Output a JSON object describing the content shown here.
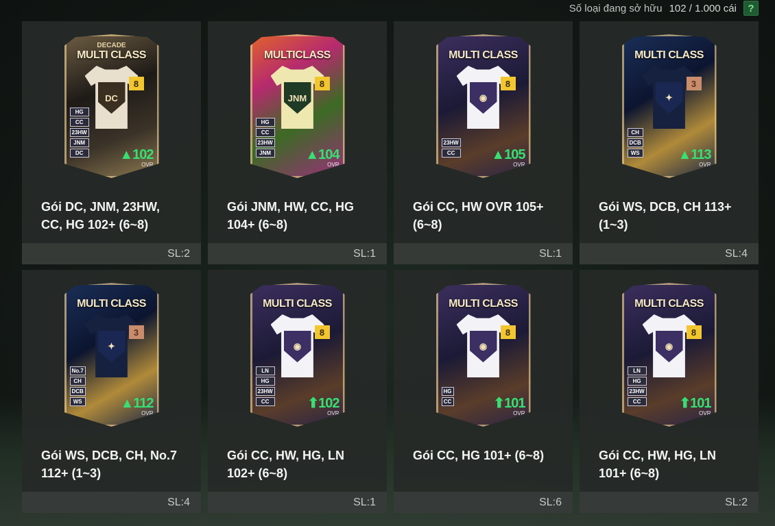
{
  "header": {
    "owned_label": "Số loại đang sở hữu",
    "owned_count": "102 / 1.000 cái",
    "help_label": "?"
  },
  "packs": [
    {
      "title": "Gói DC, JNM, 23HW, CC, HG 102+ (6~8)",
      "qty": "SL:2",
      "card": {
        "subtitle": "DECADE",
        "label": "MULTI CLASS",
        "crest": "DC",
        "grade": "8",
        "grade_type": "gold",
        "tags": [
          "HG",
          "CC",
          "23HW",
          "JNM",
          "DC"
        ],
        "ovr": "▲102",
        "ovr_label": "OVR",
        "bg": "linear-gradient(160deg,#6e5d43 0%,#1d1a17 40%,#3b3328 70%,#8f7a52 100%)",
        "shirt": "#e9dfcd",
        "crest_bg": "#3a2f21"
      }
    },
    {
      "title": "Gói JNM, HW, CC, HG 104+ (6~8)",
      "qty": "SL:1",
      "card": {
        "subtitle": "",
        "label": "MULTICLASS",
        "crest": "JNM",
        "grade": "8",
        "grade_type": "gold",
        "tags": [
          "HG",
          "CC",
          "23HW",
          "JNM"
        ],
        "ovr": "▲104",
        "ovr_label": "OVR",
        "bg": "linear-gradient(150deg,#e2652a 0%,#b62a6e 30%,#3c6a24 60%,#9c2e7c 100%)",
        "shirt": "#efe7b0",
        "crest_bg": "#1f3a25"
      }
    },
    {
      "title": "Gói CC, HW OVR 105+ (6~8)",
      "qty": "SL:1",
      "card": {
        "subtitle": "",
        "label": "MULTI CLASS",
        "crest": "◉",
        "grade": "8",
        "grade_type": "gold",
        "tags": [
          "23HW",
          "CC"
        ],
        "ovr": "▲105",
        "ovr_label": "OVR",
        "bg": "linear-gradient(160deg,#3d2f5e 0%,#1b1a36 45%,#5a3d2a 75%,#2a2447 100%)",
        "shirt": "#f3f2f6",
        "crest_bg": "#3b2f63"
      }
    },
    {
      "title": "Gói WS, DCB, CH 113+ (1~3)",
      "qty": "SL:4",
      "card": {
        "subtitle": "",
        "label": "MULTI CLASS",
        "crest": "✦",
        "grade": "3",
        "grade_type": "bronze",
        "tags": [
          "CH",
          "DCB",
          "WS"
        ],
        "ovr": "▲113",
        "ovr_label": "OVR",
        "bg": "linear-gradient(150deg,#1b2f58 0%,#0c1530 40%,#b08a3a 70%,#182646 100%)",
        "shirt": "#16213f",
        "crest_bg": "#1a2752"
      }
    },
    {
      "title": "Gói WS, DCB, CH, No.7 112+ (1~3)",
      "qty": "SL:4",
      "card": {
        "subtitle": "",
        "label": "MULTI CLASS",
        "crest": "✦",
        "grade": "3",
        "grade_type": "bronze",
        "tags": [
          "No.7",
          "CH",
          "DCB",
          "WS"
        ],
        "ovr": "▲112",
        "ovr_label": "OVR",
        "bg": "linear-gradient(150deg,#1b2f58 0%,#0c1530 40%,#b08a3a 70%,#182646 100%)",
        "shirt": "#16213f",
        "crest_bg": "#1a2752"
      }
    },
    {
      "title": "Gói CC, HW, HG, LN 102+ (6~8)",
      "qty": "SL:1",
      "card": {
        "subtitle": "",
        "label": "MULTI CLASS",
        "crest": "◉",
        "grade": "8",
        "grade_type": "gold",
        "tags": [
          "LN",
          "HG",
          "23HW",
          "CC"
        ],
        "ovr": "⬆102",
        "ovr_label": "OVR",
        "bg": "linear-gradient(160deg,#3d2f5e 0%,#1b1a36 45%,#5a3d2a 75%,#2a2447 100%)",
        "shirt": "#f3f2f6",
        "crest_bg": "#3b2f63"
      }
    },
    {
      "title": "Gói CC, HG 101+ (6~8)",
      "qty": "SL:6",
      "card": {
        "subtitle": "",
        "label": "MULTI CLASS",
        "crest": "◉",
        "grade": "8",
        "grade_type": "gold",
        "tags": [
          "HG",
          "CC"
        ],
        "ovr": "⬆101",
        "ovr_label": "OVR",
        "bg": "linear-gradient(160deg,#3d2f5e 0%,#1b1a36 45%,#5a3d2a 75%,#2a2447 100%)",
        "shirt": "#f3f2f6",
        "crest_bg": "#3b2f63"
      }
    },
    {
      "title": "Gói CC, HW, HG, LN 101+ (6~8)",
      "qty": "SL:2",
      "card": {
        "subtitle": "",
        "label": "MULTI CLASS",
        "crest": "◉",
        "grade": "8",
        "grade_type": "gold",
        "tags": [
          "LN",
          "HG",
          "23HW",
          "CC"
        ],
        "ovr": "⬆101",
        "ovr_label": "OVR",
        "bg": "linear-gradient(160deg,#3d2f5e 0%,#1b1a36 45%,#5a3d2a 75%,#2a2447 100%)",
        "shirt": "#f3f2f6",
        "crest_bg": "#3b2f63"
      }
    }
  ]
}
